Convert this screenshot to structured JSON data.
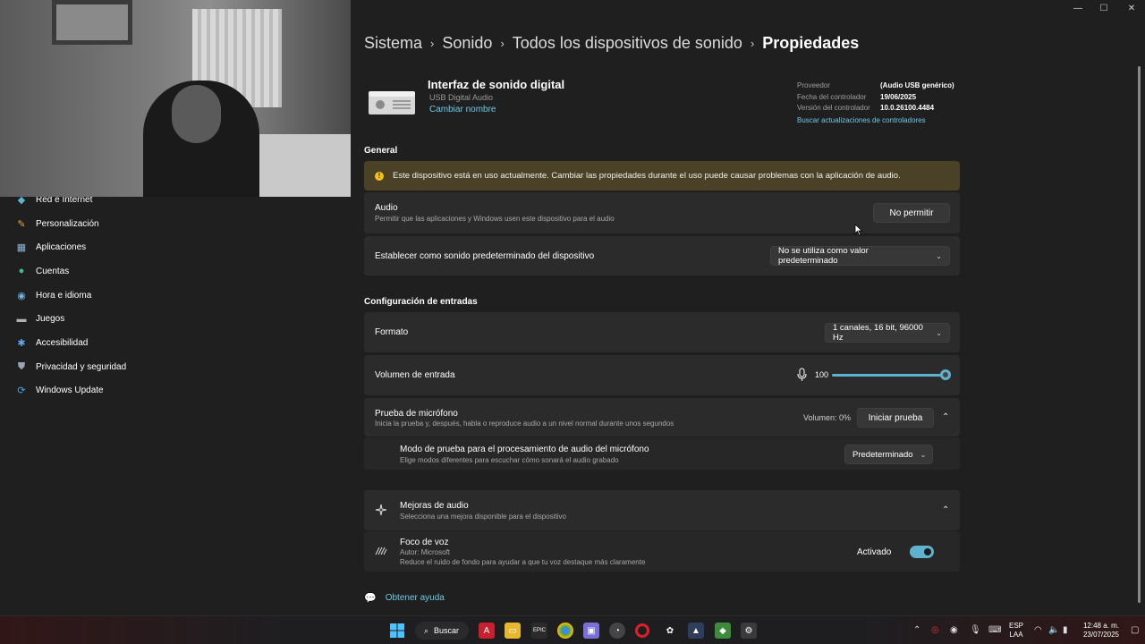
{
  "window": {
    "minimize": "—",
    "maximize": "☐",
    "close": "✕"
  },
  "breadcrumb": [
    "Sistema",
    "Sonido",
    "Todos los dispositivos de sonido",
    "Propiedades"
  ],
  "sidebar": {
    "items": [
      {
        "label": "Red e Internet",
        "icon": "network-icon"
      },
      {
        "label": "Personalización",
        "icon": "brush-icon"
      },
      {
        "label": "Aplicaciones",
        "icon": "apps-icon"
      },
      {
        "label": "Cuentas",
        "icon": "person-icon"
      },
      {
        "label": "Hora e idioma",
        "icon": "globe-clock-icon"
      },
      {
        "label": "Juegos",
        "icon": "gamepad-icon"
      },
      {
        "label": "Accesibilidad",
        "icon": "accessibility-icon"
      },
      {
        "label": "Privacidad y seguridad",
        "icon": "shield-icon"
      },
      {
        "label": "Windows Update",
        "icon": "update-icon"
      }
    ]
  },
  "device": {
    "title": "Interfaz de sonido digital",
    "subtitle": "USB Digital Audio",
    "rename": "Cambiar nombre",
    "driver": {
      "provider_label": "Proveedor",
      "provider": "(Audio USB genérico)",
      "date_label": "Fecha del controlador",
      "date": "19/06/2025",
      "version_label": "Versión del controlador",
      "version": "10.0.26100.4484",
      "update_link": "Buscar actualizaciones de controladores"
    }
  },
  "general": {
    "title": "General",
    "warning": "Este dispositivo está en uso actualmente. Cambiar las propiedades durante el uso puede causar problemas con la aplicación de audio.",
    "audio_label": "Audio",
    "audio_desc": "Permitir que las aplicaciones y Windows usen este dispositivo para el audio",
    "audio_button": "No permitir",
    "default_label": "Establecer como sonido predeterminado del dispositivo",
    "default_value": "No se utiliza como valor predeterminado"
  },
  "inputs": {
    "title": "Configuración de entradas",
    "format_label": "Formato",
    "format_value": "1 canales, 16 bit, 96000 Hz",
    "volume_label": "Volumen de entrada",
    "volume_value": "100",
    "test_label": "Prueba de micrófono",
    "test_desc": "Inicia la prueba y, después, habla o reproduce audio a un nivel normal durante unos segundos",
    "test_volume": "Volumen: 0%",
    "test_button": "Iniciar prueba",
    "mode_label": "Modo de prueba para el procesamiento de audio del micrófono",
    "mode_desc": "Elige modos diferentes para escuchar cómo sonará el audio grabado",
    "mode_value": "Predeterminado"
  },
  "enhancements": {
    "label": "Mejoras de audio",
    "desc": "Selecciona una mejora disponible para el dispositivo",
    "voice_label": "Foco de voz",
    "voice_author": "Autor: Microsoft",
    "voice_desc": "Reduce el ruido de fondo para ayudar a que tu voz destaque más claramente",
    "voice_state": "Activado"
  },
  "help": {
    "label": "Obtener ayuda"
  },
  "taskbar": {
    "search": "Buscar",
    "lang_top": "ESP",
    "lang_bottom": "LAA",
    "time": "12:48 a. m.",
    "date": "23/07/2025"
  },
  "colors": {
    "accent": "#5fb2ce",
    "link": "#6fc8e8",
    "warning_bg": "#4a4126"
  }
}
